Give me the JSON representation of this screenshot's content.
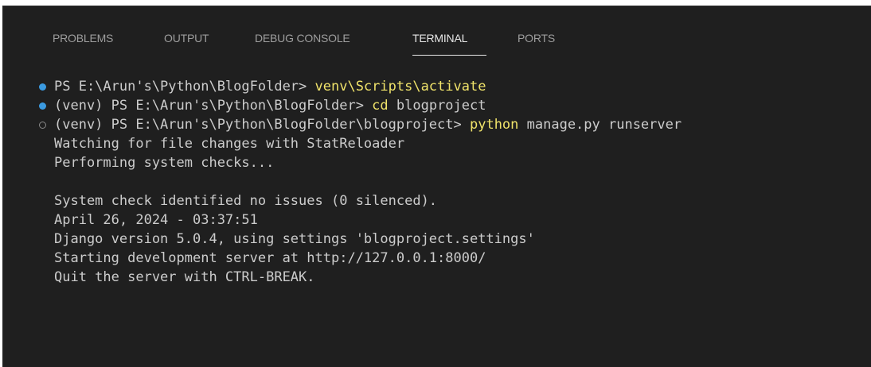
{
  "tabs": [
    {
      "label": "PROBLEMS",
      "active": false
    },
    {
      "label": "OUTPUT",
      "active": false
    },
    {
      "label": "DEBUG CONSOLE",
      "active": false
    },
    {
      "label": "TERMINAL",
      "active": true
    },
    {
      "label": "PORTS",
      "active": false
    }
  ],
  "terminal": {
    "lines": [
      {
        "prompt": "PS E:\\Arun's\\Python\\BlogFolder> ",
        "cmd": "venv\\Scripts\\activate",
        "args": "",
        "decoration": "success"
      },
      {
        "prompt": "(venv) PS E:\\Arun's\\Python\\BlogFolder> ",
        "cmd": "cd",
        "args": " blogproject",
        "decoration": "success"
      },
      {
        "prompt": "(venv) PS E:\\Arun's\\Python\\BlogFolder\\blogproject> ",
        "cmd": "python",
        "args": " manage.py runserver",
        "decoration": "running"
      },
      {
        "text": "Watching for file changes with StatReloader"
      },
      {
        "text": "Performing system checks..."
      },
      {
        "text": ""
      },
      {
        "text": "System check identified no issues (0 silenced)."
      },
      {
        "text": "April 26, 2024 - 03:37:51"
      },
      {
        "text": "Django version 5.0.4, using settings 'blogproject.settings'"
      },
      {
        "text": "Starting development server at http://127.0.0.1:8000/"
      },
      {
        "text": "Quit the server with CTRL-BREAK."
      }
    ]
  },
  "colors": {
    "background": "#1f1f1f",
    "text": "#cccccc",
    "command": "#f0e36a",
    "success_decoration": "#3b9ae0",
    "tab_inactive": "#9d9d9d",
    "tab_active": "#e7e7e7"
  }
}
